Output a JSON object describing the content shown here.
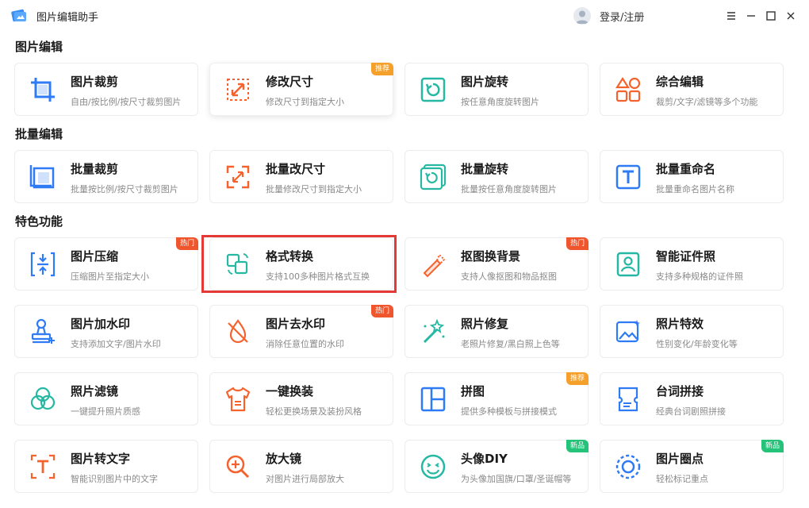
{
  "app": {
    "title": "图片编辑助手",
    "login_label": "登录/注册"
  },
  "sections": {
    "edit": "图片编辑",
    "batch": "批量编辑",
    "features": "特色功能"
  },
  "cards": {
    "crop": {
      "name": "图片裁剪",
      "desc": "自由/按比例/按尺寸裁剪图片"
    },
    "resize": {
      "name": "修改尺寸",
      "desc": "修改尺寸到指定大小",
      "badge": "推荐"
    },
    "rotate": {
      "name": "图片旋转",
      "desc": "按任意角度旋转图片"
    },
    "combo": {
      "name": "综合编辑",
      "desc": "裁剪/文字/滤镜等多个功能"
    },
    "batch_crop": {
      "name": "批量裁剪",
      "desc": "批量按比例/按尺寸裁剪图片"
    },
    "batch_resize": {
      "name": "批量改尺寸",
      "desc": "批量修改尺寸到指定大小"
    },
    "batch_rotate": {
      "name": "批量旋转",
      "desc": "批量按任意角度旋转图片"
    },
    "batch_rename": {
      "name": "批量重命名",
      "desc": "批量重命名图片名称"
    },
    "compress": {
      "name": "图片压缩",
      "desc": "压缩图片至指定大小",
      "badge": "热门"
    },
    "convert": {
      "name": "格式转换",
      "desc": "支持100多种图片格式互换"
    },
    "cutout": {
      "name": "抠图换背景",
      "desc": "支持人像抠图和物品抠图",
      "badge": "热门"
    },
    "idphoto": {
      "name": "智能证件照",
      "desc": "支持多种规格的证件照"
    },
    "watermark_add": {
      "name": "图片加水印",
      "desc": "支持添加文字/图片水印"
    },
    "watermark_remove": {
      "name": "图片去水印",
      "desc": "消除任意位置的水印",
      "badge": "热门"
    },
    "restore": {
      "name": "照片修复",
      "desc": "老照片修复/黑白照上色等"
    },
    "effects": {
      "name": "照片特效",
      "desc": "性别变化/年龄变化等"
    },
    "filter": {
      "name": "照片滤镜",
      "desc": "一键提升照片质感"
    },
    "outfit": {
      "name": "一键换装",
      "desc": "轻松更换场景及装扮风格"
    },
    "collage": {
      "name": "拼图",
      "desc": "提供多种模板与拼接模式",
      "badge": "推荐"
    },
    "subtitle": {
      "name": "台词拼接",
      "desc": "经典台词剧照拼接"
    },
    "ocr": {
      "name": "图片转文字",
      "desc": "智能识别图片中的文字"
    },
    "magnifier": {
      "name": "放大镜",
      "desc": "对图片进行局部放大"
    },
    "avatar": {
      "name": "头像DIY",
      "desc": "为头像加国旗/口罩/圣诞帽等",
      "badge": "新品"
    },
    "circle": {
      "name": "图片圈点",
      "desc": "轻松标记重点",
      "badge": "新品"
    }
  },
  "colors": {
    "blue": "#2f7bf5",
    "orange": "#f5622d",
    "teal": "#27b8a3",
    "badge_orange": "#f5a02a",
    "badge_red": "#f0562d",
    "badge_green": "#25c37a",
    "highlight": "#e53935"
  }
}
